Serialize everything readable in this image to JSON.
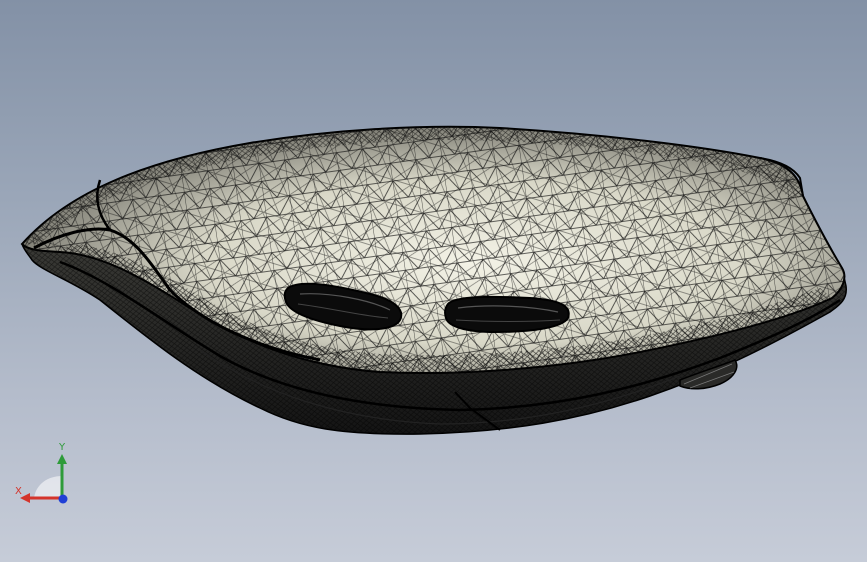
{
  "viewport": {
    "background_top": "#8391a6",
    "background_bottom": "#c6ccd8",
    "display_mode": "wireframe-mesh"
  },
  "model": {
    "description_icon": "mesh-shell-icon",
    "surface_color": "#ecebdc",
    "edge_color": "#0d0d0d",
    "vents": 2
  },
  "triad": {
    "x_label": "X",
    "y_label": "Y",
    "x_color": "#d4342b",
    "y_color": "#2e9b3a",
    "z_color": "#1f3fd6"
  }
}
